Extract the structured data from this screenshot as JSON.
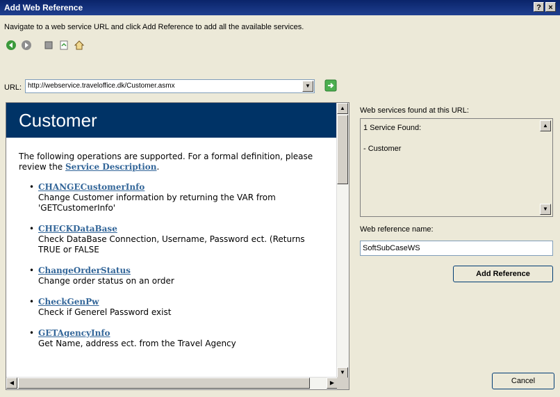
{
  "window": {
    "title": "Add Web Reference",
    "help_label": "?",
    "close_label": "×"
  },
  "instruction": "Navigate to a web service URL and click Add Reference to add all the available services.",
  "toolbar": {
    "icons": [
      "back-icon",
      "forward-icon",
      "stop-icon",
      "refresh-icon",
      "home-icon"
    ]
  },
  "url": {
    "label": "URL:",
    "value": "http://webservice.traveloffice.dk/Customer.asmx",
    "dropdown_glyph": "▼",
    "go_icon": "go-arrow-icon"
  },
  "browser": {
    "heading": "Customer",
    "intro_prefix": "The following operations are supported. For a formal definition, please review the ",
    "intro_link": "Service Description",
    "intro_suffix": ".",
    "operations": [
      {
        "name": "CHANGECustomerInfo",
        "desc": "Change Customer information by returning the VAR from 'GETCustomerInfo'"
      },
      {
        "name": "CHECKDataBase",
        "desc": "Check DataBase Connection, Username, Password ect. (Returns TRUE or FALSE"
      },
      {
        "name": "ChangeOrderStatus",
        "desc": "Change order status on an order"
      },
      {
        "name": "CheckGenPw",
        "desc": "Check if Generel Password exist"
      },
      {
        "name": "GETAgencyInfo",
        "desc": "Get Name, address ect. from the Travel Agency"
      }
    ],
    "bullet": "•",
    "scroll_up": "▲",
    "scroll_down": "▼",
    "scroll_left": "◀",
    "scroll_right": "▶"
  },
  "found": {
    "label": "Web services found at this URL:",
    "count_text": "1 Service Found:",
    "service": "- Customer"
  },
  "reference_name": {
    "label": "Web reference name:",
    "value": "SoftSubCaseWS"
  },
  "buttons": {
    "add_reference": "Add Reference",
    "cancel": "Cancel"
  },
  "colors": {
    "title_bar": "#0a246a",
    "page_heading_bg": "#003366",
    "link": "#336699",
    "dialog_bg": "#ece9d8"
  }
}
